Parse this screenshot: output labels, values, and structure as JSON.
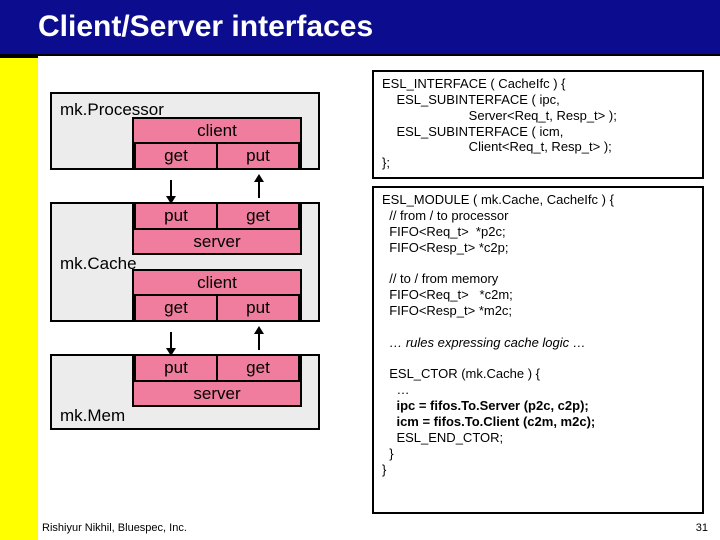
{
  "title": "Client/Server interfaces",
  "modules": {
    "processor": "mk.Processor",
    "cache": "mk.Cache",
    "mem": "mk.Mem"
  },
  "roles": {
    "client": "client",
    "server": "server",
    "get": "get",
    "put": "put"
  },
  "code": {
    "interface": "ESL_INTERFACE ( CacheIfc ) {\n    ESL_SUBINTERFACE ( ipc,\n                        Server<Req_t, Resp_t> );\n    ESL_SUBINTERFACE ( icm,\n                        Client<Req_t, Resp_t> );\n};",
    "module_head": "ESL_MODULE ( mk.Cache, CacheIfc ) {\n  // from / to processor\n  FIFO<Req_t>  *p2c;\n  FIFO<Resp_t> *c2p;",
    "module_tofrom": "  // to / from memory\n  FIFO<Req_t>   *c2m;\n  FIFO<Resp_t> *m2c;",
    "module_rules": "  … rules expressing cache logic …",
    "module_ctor": "  ESL_CTOR (mk.Cache ) {\n    …\n    ipc = fifos.To.Server (p2c, c2p);\n    icm = fifos.To.Client (c2m, m2c);\n    ESL_END_CTOR;\n  }\n}"
  },
  "footer": "Rishiyur Nikhil, Bluespec, Inc.",
  "page": "31"
}
